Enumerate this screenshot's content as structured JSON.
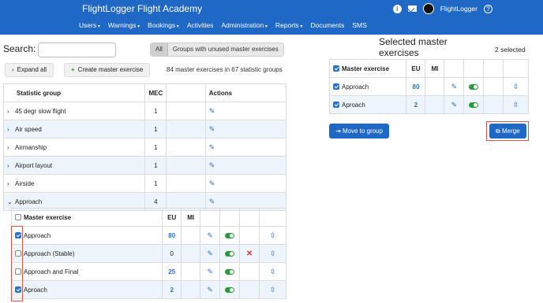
{
  "brand": "FlightLogger Flight Academy",
  "nav": [
    "Users",
    "Warnings",
    "Bookings",
    "Activities",
    "Administration",
    "Reports",
    "Documents",
    "SMS"
  ],
  "user": {
    "name": "FlightLogger"
  },
  "search": {
    "label": "Search:",
    "placeholder": "",
    "value": ""
  },
  "filter": {
    "all": "All",
    "unused": "Groups with unused master exercises",
    "selected": "All"
  },
  "buttons": {
    "expand_all": "Expand all",
    "create_master": "Create master exercise",
    "move_to_group": "Move to group",
    "merge": "Merge"
  },
  "summary": "84 master exercises in 67 statistic groups",
  "groups_table": {
    "headers": {
      "group": "Statistic group",
      "mec": "MEC",
      "actions": "Actions"
    },
    "rows": [
      {
        "name": "45 degr slow flight",
        "mec": "1"
      },
      {
        "name": "Air speed",
        "mec": "1"
      },
      {
        "name": "Airmanship",
        "mec": "1"
      },
      {
        "name": "Airport layout",
        "mec": "1"
      },
      {
        "name": "Airside",
        "mec": "1"
      },
      {
        "name": "Approach",
        "mec": "4",
        "expanded": true
      }
    ]
  },
  "exercises_table": {
    "headers": {
      "exercise": "Master exercise",
      "eu": "EU",
      "mi": "MI"
    },
    "rows": [
      {
        "name": "Approach",
        "eu": "80",
        "checked": true,
        "deletable": false
      },
      {
        "name": "Approach (Stable)",
        "eu": "0",
        "checked": false,
        "deletable": true
      },
      {
        "name": "Approach and Final",
        "eu": "25",
        "checked": false,
        "deletable": false
      },
      {
        "name": "Aproach",
        "eu": "2",
        "checked": true,
        "deletable": false
      }
    ]
  },
  "selected": {
    "title": "Selected master exercises",
    "count": "2 selected",
    "headers": {
      "exercise": "Master exercise",
      "eu": "EU",
      "mi": "MI"
    },
    "rows": [
      {
        "name": "Approach",
        "eu": "80"
      },
      {
        "name": "Aproach",
        "eu": "2"
      }
    ]
  },
  "colors": {
    "navbar": "#1f68c5",
    "link": "#2a73c7",
    "toggle_on": "#2a9b3a",
    "highlight_box": "#d9534f",
    "row_stripe": "#eef4fb"
  }
}
